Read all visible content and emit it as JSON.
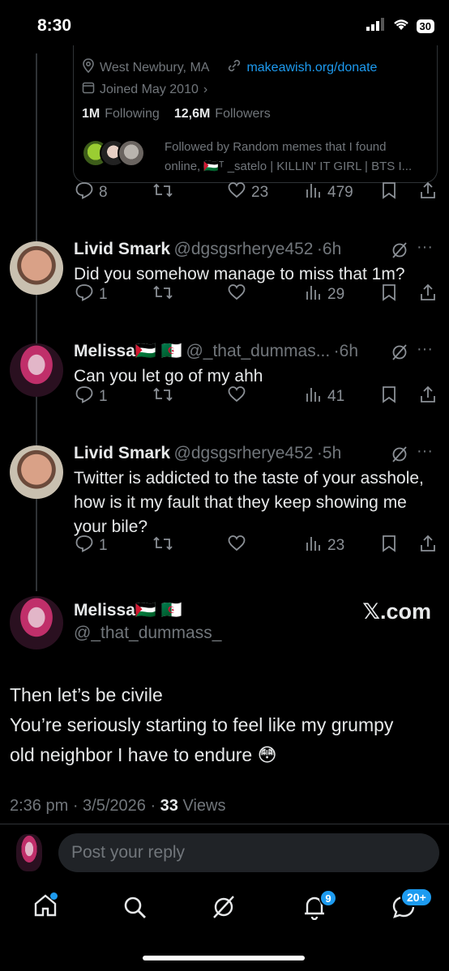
{
  "status": {
    "time": "8:30",
    "battery": "30"
  },
  "profile_card": {
    "location": "West Newbury, MA",
    "website": "makeawish.org/donate",
    "joined": "Joined May 2010",
    "following_count": "1M",
    "following_label": "Following",
    "followers_count": "12,6M",
    "followers_label": "Followers",
    "followed_by_line1": "Followed by Random memes that I found",
    "followed_by_line2": "online, 🇵🇸ᵀ _satelo | KILLIN' IT GIRL | BTS I..."
  },
  "top_actions": {
    "replies": "8",
    "likes": "23",
    "views": "479"
  },
  "tweets": [
    {
      "name": "Livid Smark",
      "handle": "@dgsgsrherye452",
      "time": "6h",
      "text": "Did you somehow manage to miss that 1m?",
      "replies": "1",
      "views": "29"
    },
    {
      "name": "Melissa🇵🇸 🇩🇿",
      "handle": "@_that_dummas...",
      "time": "6h",
      "text": "Can you let go of my ahh",
      "replies": "1",
      "views": "41"
    },
    {
      "name": "Livid Smark",
      "handle": "@dgsgsrherye452",
      "time": "5h",
      "text": "Twitter is addicted to the taste of your asshole, how is it my fault that they keep showing me your bile?",
      "replies": "1",
      "views": "23"
    }
  ],
  "main_tweet": {
    "name": "Melissa🇵🇸 🇩🇿",
    "handle": "@_that_dummass_",
    "watermark": "𝕏.com",
    "line1": "Then let’s be civile",
    "line2": "You’re seriously starting to feel like my grumpy",
    "line3": "old neighbor I have to endure 😳",
    "timestamp": "2:36 pm · 3/5/2026 ·",
    "views_count": "33",
    "views_label": "Views"
  },
  "reply_box": {
    "placeholder": "Post your reply"
  },
  "bottom_nav": {
    "notifications_badge": "9",
    "messages_badge": "20+"
  }
}
